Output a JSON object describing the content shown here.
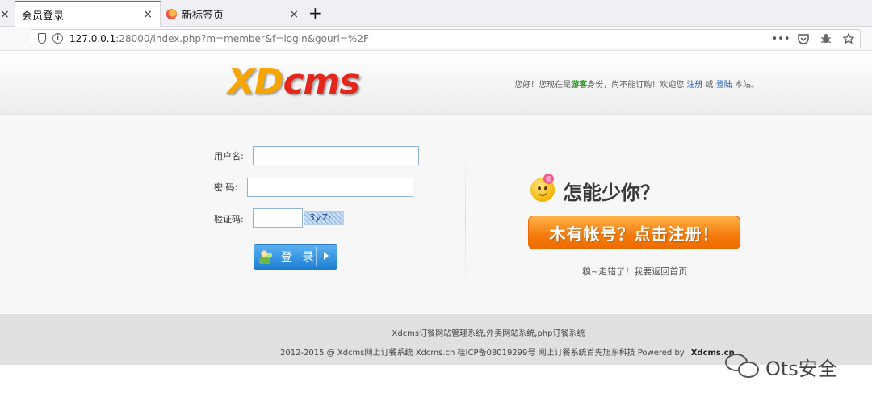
{
  "browser": {
    "tabs": [
      {
        "title": "会员登录",
        "active": true
      },
      {
        "title": "新标签页",
        "active": false
      }
    ],
    "stub_close": "×",
    "close_glyph": "×",
    "new_tab_glyph": "+",
    "url_host": "127.0.0.1",
    "url_rest": ":28000/index.php?m=member&f=login&gourl=%2F",
    "actions": [
      "more-icon",
      "pocket-icon",
      "extension-icon",
      "bookmark-star-icon"
    ]
  },
  "header": {
    "logo_xd": "XD",
    "logo_cms": "cms",
    "welcome_prefix": "您好！您现在是",
    "welcome_guest": "游客",
    "welcome_mid": "身份，尚不能订购！欢迎您",
    "register_link": "注册",
    "or_text": "或",
    "login_link": "登陆",
    "welcome_suffix": "本站。"
  },
  "login_form": {
    "username_label": "用户名:",
    "password_label": "密 码:",
    "captcha_label": "验证码:",
    "username_value": "",
    "password_value": "",
    "captcha_value": "",
    "captcha_image_text": "3y7c",
    "submit_label": "登 录"
  },
  "register_panel": {
    "title": "怎能少你？",
    "button_label": "木有帐号？点击注册！",
    "back_link": "糗~走错了！我要返回首页"
  },
  "footer": {
    "line1": "Xdcms订餐网站管理系统,外卖网站系统,php订餐系统",
    "line2": "2012-2015 @ Xdcms网上订餐系统 Xdcms.cn 桂ICP备08019299号 网上订餐系统首先旭东科技 Powered by",
    "brand": "Xdcms.cn"
  },
  "watermark": {
    "text": "Ots安全"
  },
  "colors": {
    "accent_blue": "#1f7fd2",
    "register_orange": "#f47b0b",
    "guest_green": "#2a9a2a",
    "link_blue": "#1e5fb4"
  }
}
